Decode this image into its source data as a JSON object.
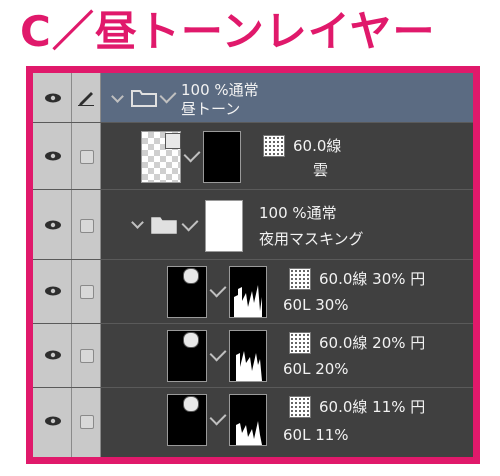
{
  "headline": "C／昼トーンレイヤー",
  "colors": {
    "accent": "#e0196b",
    "panel": "#404040",
    "selected_row": "#5b6b82",
    "gutter": "#c9c9c9"
  },
  "layers": [
    {
      "line1": "100 %通常",
      "line2": "昼トーン",
      "selected": true,
      "type": "folder"
    },
    {
      "line1": "60.0線",
      "line2": "雲",
      "type": "tone"
    },
    {
      "line1": "100 %通常",
      "line2": "夜用マスキング",
      "type": "folder"
    },
    {
      "line1": "60.0線 30% 円",
      "line2": "60L 30%",
      "type": "tone"
    },
    {
      "line1": "60.0線 20% 円",
      "line2": "60L 20%",
      "type": "tone"
    },
    {
      "line1": "60.0線 11% 円",
      "line2": "60L 11%",
      "type": "tone"
    }
  ]
}
